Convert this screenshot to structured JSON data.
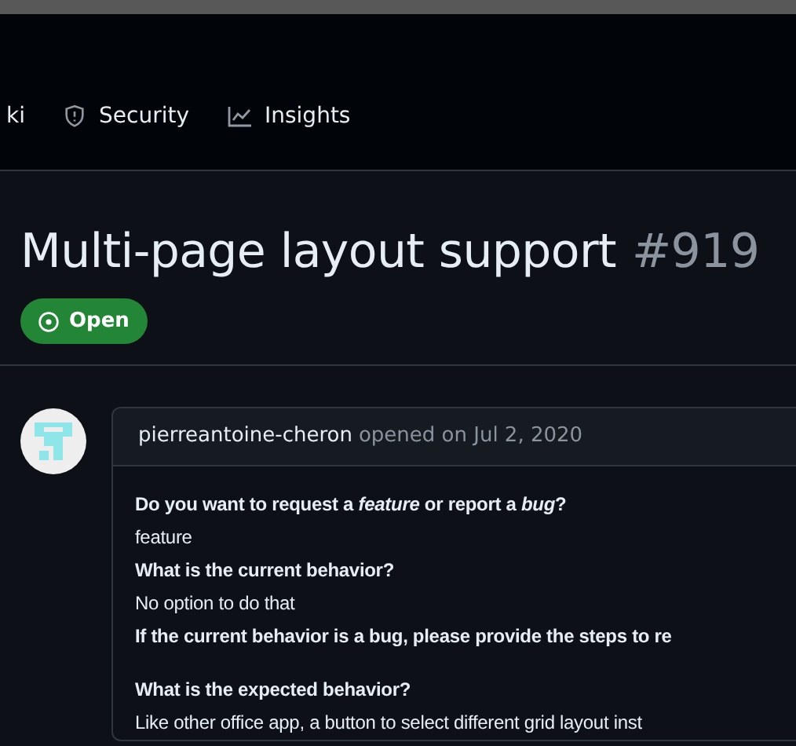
{
  "repo_nav": {
    "tabs": [
      {
        "label": "ki"
      },
      {
        "label": "Security"
      },
      {
        "label": "Insights"
      }
    ]
  },
  "issue": {
    "title": "Multi-page layout support",
    "number": "#919",
    "state": {
      "label": "Open"
    }
  },
  "comment": {
    "author": "pierreantoine-cheron",
    "meta": "opened on Jul 2, 2020",
    "body": [
      {
        "kind": "question",
        "text": "Do you want to request a *feature* or report a *bug*?"
      },
      {
        "kind": "answer",
        "text": "feature"
      },
      {
        "kind": "question",
        "text": "What is the current behavior?"
      },
      {
        "kind": "answer",
        "text": "No option to do that"
      },
      {
        "kind": "question",
        "text": "If the current behavior is a bug, please provide the steps to re"
      },
      {
        "kind": "gap"
      },
      {
        "kind": "question",
        "text": "What is the expected behavior?"
      },
      {
        "kind": "answer",
        "text": "Like other office app, a button to select different grid layout inst"
      }
    ]
  }
}
